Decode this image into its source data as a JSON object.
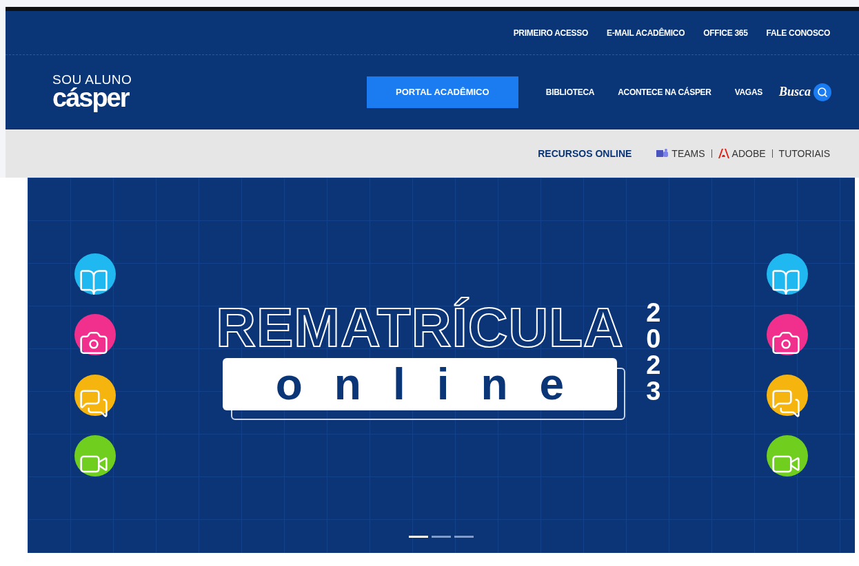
{
  "top_links": [
    "PRIMEIRO ACESSO",
    "E-MAIL ACADÊMICO",
    "OFFICE 365",
    "FALE CONOSCO"
  ],
  "logo": {
    "line1": "SOU ALUNO",
    "line2": "cásper"
  },
  "nav": [
    {
      "label": "PORTAL ACADÊMICO",
      "kind": "button"
    },
    {
      "label": "BIBLIOTECA",
      "kind": "link"
    },
    {
      "label": "ACONTECE NA CÁSPER",
      "kind": "link"
    },
    {
      "label": "VAGAS",
      "kind": "link"
    }
  ],
  "search": {
    "label": "Busca"
  },
  "resources": {
    "title": "RECURSOS ONLINE",
    "links": [
      {
        "label": "TEAMS",
        "kind": "teams"
      },
      {
        "label": "ADOBE",
        "kind": "adobe"
      },
      {
        "label": "TUTORIAIS",
        "kind": "plain"
      }
    ]
  },
  "banner": {
    "title": "REMATRÍCULA",
    "subtitle": "online",
    "year": "2023",
    "icons": [
      {
        "kind": "book",
        "color": "#1fb8f0"
      },
      {
        "kind": "camera",
        "color": "#f0308c"
      },
      {
        "kind": "chat",
        "color": "#f5b50e"
      },
      {
        "kind": "video",
        "color": "#6fce1e"
      }
    ],
    "dots": [
      {
        "selected": true
      },
      {
        "selected": false
      },
      {
        "selected": false
      }
    ]
  }
}
